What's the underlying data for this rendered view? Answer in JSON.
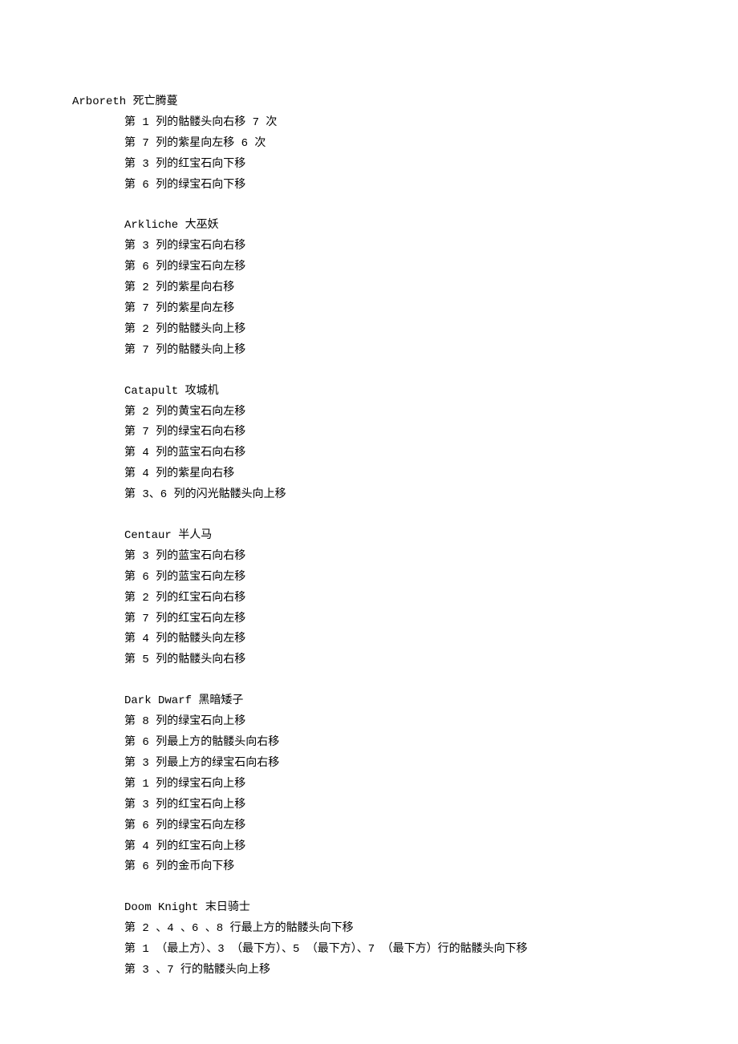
{
  "sections": [
    {
      "title": "Arboreth 死亡腾蔓",
      "titleIndent": true,
      "steps": [
        "第 1 列的骷髅头向右移 7 次",
        "第 7 列的紫星向左移 6 次",
        "第 3 列的红宝石向下移",
        "第 6 列的绿宝石向下移"
      ]
    },
    {
      "title": "Arkliche 大巫妖",
      "titleIndent": false,
      "steps": [
        "第 3 列的绿宝石向右移",
        "第 6 列的绿宝石向左移",
        "第 2 列的紫星向右移",
        "第 7 列的紫星向左移",
        "第 2 列的骷髅头向上移",
        "第 7 列的骷髅头向上移"
      ]
    },
    {
      "title": "Catapult 攻城机",
      "titleIndent": false,
      "steps": [
        "第 2 列的黄宝石向左移",
        "第 7 列的绿宝石向右移",
        "第 4 列的蓝宝石向右移",
        "第 4 列的紫星向右移",
        "第 3、6 列的闪光骷髅头向上移"
      ]
    },
    {
      "title": "Centaur 半人马",
      "titleIndent": false,
      "steps": [
        "第 3 列的蓝宝石向右移",
        "第 6 列的蓝宝石向左移",
        "第 2 列的红宝石向右移",
        "第 7 列的红宝石向左移",
        "第 4 列的骷髅头向左移",
        "第 5 列的骷髅头向右移"
      ]
    },
    {
      "title": "Dark Dwarf 黑暗矮子",
      "titleIndent": false,
      "steps": [
        "第 8 列的绿宝石向上移",
        "第 6 列最上方的骷髅头向右移",
        "第 3 列最上方的绿宝石向右移",
        "第 1 列的绿宝石向上移",
        "第 3 列的红宝石向上移",
        "第 6 列的绿宝石向左移",
        "第 4 列的红宝石向上移",
        "第 6 列的金币向下移"
      ]
    },
    {
      "title": "Doom Knight 末日骑士",
      "titleIndent": false,
      "steps": [
        "第 2 、4 、6 、8 行最上方的骷髅头向下移",
        "第 1 （最上方）、3 （最下方）、5 （最下方）、7 （最下方）行的骷髅头向下移",
        "第 3 、7 行的骷髅头向上移"
      ]
    }
  ]
}
